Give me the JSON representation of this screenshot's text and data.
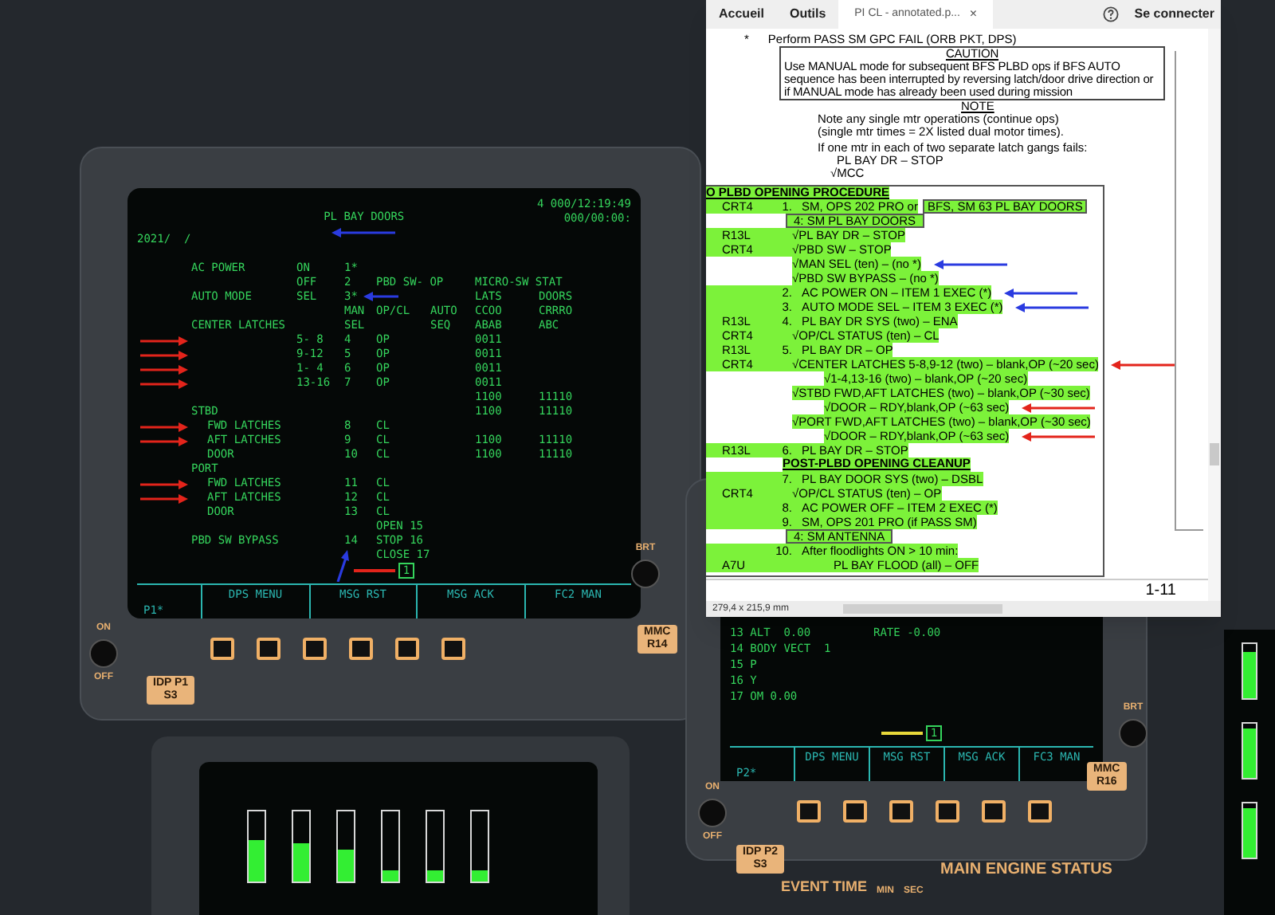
{
  "cockpit": {
    "crt_1": {
      "header": {
        "code": "2021/  /",
        "title": "PL BAY DOORS",
        "time_1": "4 000/12:19:49",
        "time_2": "000/00:00:",
        "title_arrow": {
          "kind": "left",
          "color": "#2a3be0"
        }
      },
      "rows": [
        {
          "label": "AC POWER",
          "state": "ON",
          "item": "1*"
        },
        {
          "state": "OFF",
          "item": "2",
          "op_cl": "PBD SW- OP",
          "lats": "MICRO-SW STAT"
        },
        {
          "label": "AUTO MODE",
          "state": "SEL",
          "item": "3*",
          "lats": "LATS",
          "doors": "DOORS",
          "arrow": {
            "kind": "left",
            "color": "#2a3be0"
          }
        },
        {
          "item": "MAN",
          "op_cl": "OP/CL",
          "auto": "AUTO",
          "lats": "CCOO",
          "doors": "CRRRO"
        },
        {
          "label": "CENTER LATCHES",
          "item": "SEL",
          "auto": "SEQ",
          "lats": "ABAB",
          "doors": "ABC"
        },
        {
          "state": "5- 8",
          "item": "4",
          "op_cl": "OP",
          "lats": "0011",
          "arrow": {
            "kind": "right",
            "color": "#e3241b"
          }
        },
        {
          "state": "9-12",
          "item": "5",
          "op_cl": "OP",
          "lats": "0011",
          "arrow": {
            "kind": "right",
            "color": "#e3241b"
          }
        },
        {
          "state": "1- 4",
          "item": "6",
          "op_cl": "OP",
          "lats": "0011",
          "arrow": {
            "kind": "right",
            "color": "#e3241b"
          }
        },
        {
          "state": "13-16",
          "item": "7",
          "op_cl": "OP",
          "lats": "0011",
          "arrow": {
            "kind": "right",
            "color": "#e3241b"
          }
        },
        {
          "lats": "1100",
          "doors": "11110"
        },
        {
          "label": "STBD",
          "lats": "1100",
          "doors": "11110"
        },
        {
          "kind": "sub",
          "label": "FWD LATCHES",
          "item": "8",
          "op_cl": "CL",
          "arrow": {
            "kind": "right",
            "color": "#e3241b"
          }
        },
        {
          "kind": "sub",
          "label": "AFT LATCHES",
          "item": "9",
          "op_cl": "CL",
          "lats": "1100",
          "doors": "11110",
          "arrow": {
            "kind": "right",
            "color": "#e3241b"
          }
        },
        {
          "kind": "sub",
          "label": "DOOR",
          "item": "10",
          "op_cl": "CL",
          "lats": "1100",
          "doors": "11110"
        },
        {
          "label": "PORT"
        },
        {
          "kind": "sub",
          "label": "FWD LATCHES",
          "item": "11",
          "op_cl": "CL",
          "arrow": {
            "kind": "right",
            "color": "#e3241b"
          }
        },
        {
          "kind": "sub",
          "label": "AFT LATCHES",
          "item": "12",
          "op_cl": "CL",
          "arrow": {
            "kind": "right",
            "color": "#e3241b"
          }
        },
        {
          "kind": "sub",
          "label": "DOOR",
          "item": "13",
          "op_cl": "CL"
        },
        {
          "op_cl": "OPEN 15"
        },
        {
          "label": "PBD SW BYPASS",
          "item": "14",
          "op_cl": "STOP 16",
          "arrow": {
            "kind": "up",
            "color": "#2a3be0"
          }
        },
        {
          "op_cl": "CLOSE 17"
        }
      ],
      "page_marker": "1",
      "prompt": "P1*",
      "softkeys": [
        "DPS MENU",
        "MSG RST",
        "MSG ACK",
        "FC2 MAN"
      ]
    },
    "bezel_1": {
      "tag_left": [
        "IDP P1",
        "S3"
      ],
      "tag_right": [
        "MMC",
        "R14"
      ],
      "switch": [
        "ON",
        "OFF"
      ],
      "knob_label": "BRT"
    },
    "lower_display": {
      "gauges": [
        {
          "level": 0.6
        },
        {
          "level": 0.55
        },
        {
          "level": 0.45
        },
        {
          "level": 0.15
        },
        {
          "level": 0.15
        },
        {
          "level": 0.15
        }
      ]
    },
    "crt_2": {
      "rows": [
        {
          "text": "13 ALT  0.00",
          "right": "RATE -0.00"
        },
        {
          "text": "14 BODY VECT  1"
        },
        {
          "text": "15 P"
        },
        {
          "text": "16 Y"
        },
        {
          "text": "17 OM 0.00"
        }
      ],
      "page_marker": "1",
      "prompt": "P2*",
      "softkeys": [
        "DPS MENU",
        "MSG RST",
        "MSG ACK",
        "FC3 MAN"
      ]
    },
    "bezel_2": {
      "tag_left": [
        "IDP P2",
        "S3"
      ],
      "tag_right": [
        "MMC",
        "R16"
      ],
      "switch": [
        "ON",
        "OFF"
      ],
      "knob_label": "BRT",
      "panel_title": "MAIN ENGINE STATUS",
      "event_time": "EVENT TIME",
      "units": [
        "MIN",
        "SEC"
      ]
    },
    "right_strip": {
      "gauges": [
        {
          "level": 0.85
        },
        {
          "level": 0.9
        },
        {
          "level": 0.9
        }
      ]
    }
  },
  "pdf_viewer": {
    "menu": [
      "Accueil",
      "Outils"
    ],
    "tab": {
      "title": "PI CL - annotated.p...",
      "close": "×"
    },
    "sign_in": "Se connecter",
    "document": {
      "bullet": "*",
      "intro": "Perform PASS SM GPC FAIL (ORB PKT, DPS)",
      "caution": {
        "title": "CAUTION",
        "text": "Use MANUAL mode for subsequent BFS PLBD ops if BFS AUTO sequence has been interrupted by reversing latch/door drive direction or if MANUAL mode has already been used during mission"
      },
      "note": {
        "title": "NOTE",
        "lines": [
          "Note any single mtr operations (continue ops)",
          "(single mtr times = 2X listed dual motor times)."
        ]
      },
      "contingency": {
        "condition": "If one mtr in each of two separate latch gangs fails:",
        "action": "PL BAY DR – STOP",
        "check": "√MCC"
      },
      "procedure": {
        "title": "O PLBD OPENING PROCEDURE",
        "rows": [
          {
            "kind": "step",
            "station": "CRT4",
            "number": "1.",
            "text": "SM, OPS 202 PRO or",
            "boxed": "BFS, SM 63 PL BAY DOORS"
          },
          {
            "kind": "display",
            "text": "4: SM PL BAY DOORS"
          },
          {
            "kind": "check",
            "station": "R13L",
            "text": "√PL BAY DR – STOP"
          },
          {
            "kind": "check",
            "station": "CRT4",
            "text": "√PBD SW – STOP"
          },
          {
            "kind": "check",
            "text": "√MAN SEL (ten) – (no *)",
            "arrow": {
              "kind": "left",
              "color": "#2a3be0"
            }
          },
          {
            "kind": "check",
            "text": "√PBD SW BYPASS – (no *)"
          },
          {
            "kind": "step",
            "number": "2.",
            "text": "AC POWER ON – ITEM 1 EXEC (*)",
            "arrow": {
              "kind": "left",
              "color": "#2a3be0"
            }
          },
          {
            "kind": "step",
            "number": "3.",
            "text": "AUTO MODE SEL – ITEM 3 EXEC (*)",
            "arrow": {
              "kind": "left",
              "color": "#2a3be0"
            }
          },
          {
            "kind": "step",
            "station": "R13L",
            "number": "4.",
            "text": "PL BAY DR SYS (two) – ENA"
          },
          {
            "kind": "check",
            "station": "CRT4",
            "text": "√OP/CL STATUS (ten) – CL"
          },
          {
            "kind": "step",
            "station": "R13L",
            "number": "5.",
            "text": "PL BAY DR – OP"
          },
          {
            "kind": "check",
            "station": "CRT4",
            "text": "√CENTER LATCHES 5-8,9-12 (two) – blank,OP (~20 sec)",
            "arrow": {
              "kind": "left",
              "color": "#e3241b"
            },
            "children": [
              {
                "kind": "check",
                "text": "√1-4,13-16 (two) – blank,OP (~20 sec)"
              }
            ]
          },
          {
            "kind": "check",
            "text": "√STBD FWD,AFT LATCHES (two) – blank,OP (~30 sec)",
            "children": [
              {
                "kind": "check",
                "text": "√DOOR – RDY,blank,OP (~63 sec)",
                "arrow": {
                  "kind": "left",
                  "color": "#e3241b"
                }
              }
            ]
          },
          {
            "kind": "check",
            "text": "√PORT FWD,AFT LATCHES (two) – blank,OP (~30 sec)",
            "children": [
              {
                "kind": "check",
                "text": "√DOOR – RDY,blank,OP (~63 sec)",
                "arrow": {
                  "kind": "left",
                  "color": "#e3241b"
                }
              }
            ]
          },
          {
            "kind": "step",
            "station": "R13L",
            "number": "6.",
            "text": "PL BAY DR – STOP"
          },
          {
            "kind": "heading",
            "text": "POST-PLBD OPENING CLEANUP"
          },
          {
            "kind": "step",
            "number": "7.",
            "text": "PL BAY DOOR SYS (two) – DSBL"
          },
          {
            "kind": "check",
            "station": "CRT4",
            "text": "√OP/CL STATUS (ten) – OP"
          },
          {
            "kind": "step",
            "number": "8.",
            "text": "AC POWER OFF – ITEM 2 EXEC (*)"
          },
          {
            "kind": "step",
            "number": "9.",
            "text": "SM, OPS 201 PRO (if PASS SM)"
          },
          {
            "kind": "display",
            "text": "4: SM ANTENNA"
          },
          {
            "kind": "step",
            "number": "10.",
            "text": "After floodlights ON > 10 min:",
            "children": [
              {
                "kind": "step",
                "station": "A7U",
                "text": "PL BAY FLOOD (all) – OFF"
              }
            ]
          }
        ]
      },
      "page_number": "1-11"
    },
    "status": "279,4 x 215,9 mm"
  }
}
